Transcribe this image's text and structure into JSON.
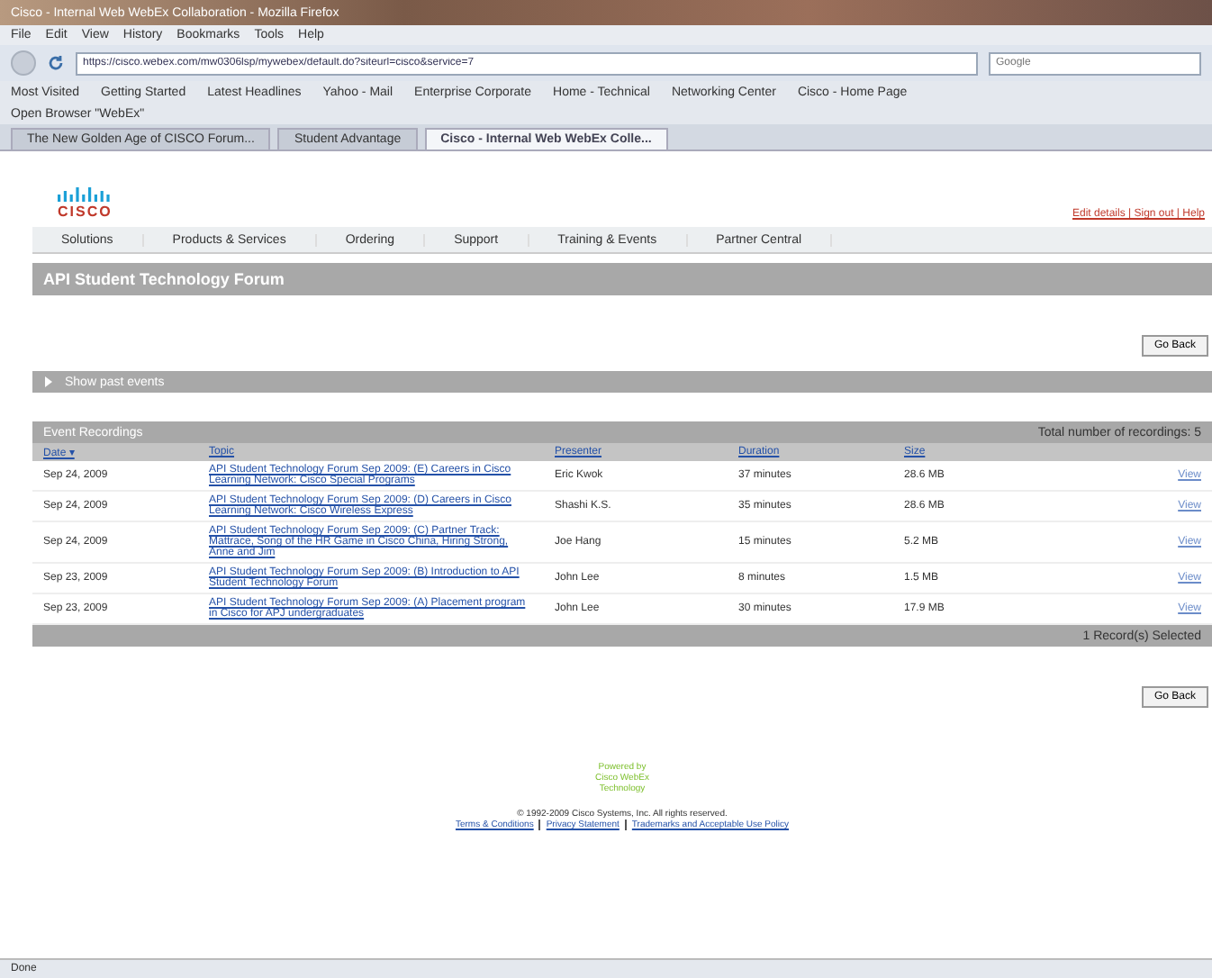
{
  "window": {
    "title": "Cisco - Internal Web WebEx Collaboration - Mozilla Firefox"
  },
  "menu": [
    "File",
    "Edit",
    "View",
    "History",
    "Bookmarks",
    "Tools",
    "Help"
  ],
  "address_bar": {
    "value": "https://cisco.webex.com/mw0306lsp/mywebex/default.do?siteurl=cisco&service=7"
  },
  "search": {
    "placeholder": "Google"
  },
  "bookmarks": [
    "Most Visited",
    "Getting Started",
    "Latest Headlines",
    "Yahoo - Mail",
    "Enterprise Corporate",
    "Home - Technical",
    "Networking Center",
    "Cisco - Home Page"
  ],
  "bookmarks_row2": [
    "Open Browser \"WebEx\""
  ],
  "tabs": [
    {
      "label": "The New Golden Age of CISCO Forum...",
      "selected": false
    },
    {
      "label": "Student Advantage",
      "selected": false
    },
    {
      "label": "Cisco - Internal Web WebEx Colle...",
      "selected": true
    }
  ],
  "header": {
    "logo": "CISCO",
    "user_links": "Edit details | Sign out | Help"
  },
  "nav": [
    "Solutions",
    "Products & Services",
    "Ordering",
    "Support",
    "Training & Events",
    "Partner Central"
  ],
  "page_title": "API Student Technology Forum",
  "top_button": "Go Back",
  "past_events": {
    "label": "Show past events",
    "expanded": false
  },
  "recordings": {
    "title": "Event Recordings",
    "total": "Total number of recordings: 5",
    "columns": [
      "Date ▾",
      "Topic",
      "Presenter",
      "Duration",
      "Size"
    ],
    "rows": [
      {
        "date": "Sep 24, 2009",
        "topic": "API Student Technology Forum Sep 2009: (E) Careers in Cisco Learning Network: Cisco Special Programs",
        "presenter": "Eric Kwok",
        "duration": "37 minutes",
        "size": "28.6 MB",
        "action": "View"
      },
      {
        "date": "Sep 24, 2009",
        "topic": "API Student Technology Forum Sep 2009: (D) Careers in Cisco Learning Network: Cisco Wireless Express",
        "presenter": "Shashi K.S.",
        "duration": "35 minutes",
        "size": "28.6 MB",
        "action": "View"
      },
      {
        "date": "Sep 24, 2009",
        "topic": "API Student Technology Forum Sep 2009: (C) Partner Track: Mattrace, Song of the HR Game in Cisco China, Hiring Strong, Anne and Jim",
        "presenter": "Joe Hang",
        "duration": "15 minutes",
        "size": "5.2 MB",
        "action": "View"
      },
      {
        "date": "Sep 23, 2009",
        "topic": "API Student Technology Forum Sep 2009: (B) Introduction to API Student Technology Forum",
        "presenter": "John Lee",
        "duration": "8 minutes",
        "size": "1.5 MB",
        "action": "View"
      },
      {
        "date": "Sep 23, 2009",
        "topic": "API Student Technology Forum Sep 2009: (A) Placement program in Cisco for APJ undergraduates",
        "presenter": "John Lee",
        "duration": "30 minutes",
        "size": "17.9 MB",
        "action": "View"
      }
    ],
    "footer": "1 Record(s) Selected"
  },
  "bottom_button": "Go Back",
  "powered": [
    "Powered by",
    "Cisco WebEx",
    "Technology"
  ],
  "copyright": "© 1992-2009 Cisco Systems, Inc. All rights reserved.",
  "footer_links": [
    "Terms & Conditions",
    "Privacy Statement",
    "Trademarks and Acceptable Use Policy"
  ],
  "status_bar": "Done"
}
